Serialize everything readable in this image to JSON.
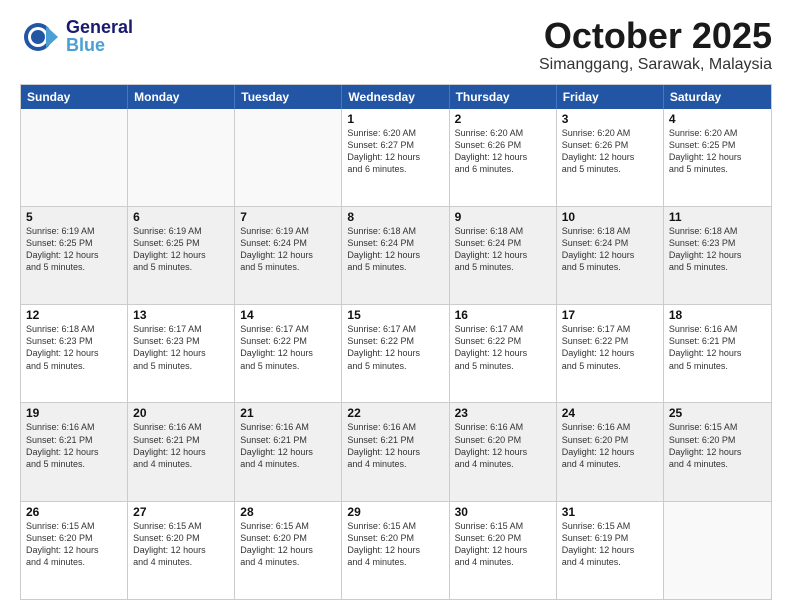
{
  "header": {
    "logo_line1": "General",
    "logo_line2": "Blue",
    "month": "October 2025",
    "location": "Simanggang, Sarawak, Malaysia"
  },
  "weekdays": [
    "Sunday",
    "Monday",
    "Tuesday",
    "Wednesday",
    "Thursday",
    "Friday",
    "Saturday"
  ],
  "rows": [
    [
      {
        "day": "",
        "text": ""
      },
      {
        "day": "",
        "text": ""
      },
      {
        "day": "",
        "text": ""
      },
      {
        "day": "1",
        "text": "Sunrise: 6:20 AM\nSunset: 6:27 PM\nDaylight: 12 hours\nand 6 minutes."
      },
      {
        "day": "2",
        "text": "Sunrise: 6:20 AM\nSunset: 6:26 PM\nDaylight: 12 hours\nand 6 minutes."
      },
      {
        "day": "3",
        "text": "Sunrise: 6:20 AM\nSunset: 6:26 PM\nDaylight: 12 hours\nand 5 minutes."
      },
      {
        "day": "4",
        "text": "Sunrise: 6:20 AM\nSunset: 6:25 PM\nDaylight: 12 hours\nand 5 minutes."
      }
    ],
    [
      {
        "day": "5",
        "text": "Sunrise: 6:19 AM\nSunset: 6:25 PM\nDaylight: 12 hours\nand 5 minutes."
      },
      {
        "day": "6",
        "text": "Sunrise: 6:19 AM\nSunset: 6:25 PM\nDaylight: 12 hours\nand 5 minutes."
      },
      {
        "day": "7",
        "text": "Sunrise: 6:19 AM\nSunset: 6:24 PM\nDaylight: 12 hours\nand 5 minutes."
      },
      {
        "day": "8",
        "text": "Sunrise: 6:18 AM\nSunset: 6:24 PM\nDaylight: 12 hours\nand 5 minutes."
      },
      {
        "day": "9",
        "text": "Sunrise: 6:18 AM\nSunset: 6:24 PM\nDaylight: 12 hours\nand 5 minutes."
      },
      {
        "day": "10",
        "text": "Sunrise: 6:18 AM\nSunset: 6:24 PM\nDaylight: 12 hours\nand 5 minutes."
      },
      {
        "day": "11",
        "text": "Sunrise: 6:18 AM\nSunset: 6:23 PM\nDaylight: 12 hours\nand 5 minutes."
      }
    ],
    [
      {
        "day": "12",
        "text": "Sunrise: 6:18 AM\nSunset: 6:23 PM\nDaylight: 12 hours\nand 5 minutes."
      },
      {
        "day": "13",
        "text": "Sunrise: 6:17 AM\nSunset: 6:23 PM\nDaylight: 12 hours\nand 5 minutes."
      },
      {
        "day": "14",
        "text": "Sunrise: 6:17 AM\nSunset: 6:22 PM\nDaylight: 12 hours\nand 5 minutes."
      },
      {
        "day": "15",
        "text": "Sunrise: 6:17 AM\nSunset: 6:22 PM\nDaylight: 12 hours\nand 5 minutes."
      },
      {
        "day": "16",
        "text": "Sunrise: 6:17 AM\nSunset: 6:22 PM\nDaylight: 12 hours\nand 5 minutes."
      },
      {
        "day": "17",
        "text": "Sunrise: 6:17 AM\nSunset: 6:22 PM\nDaylight: 12 hours\nand 5 minutes."
      },
      {
        "day": "18",
        "text": "Sunrise: 6:16 AM\nSunset: 6:21 PM\nDaylight: 12 hours\nand 5 minutes."
      }
    ],
    [
      {
        "day": "19",
        "text": "Sunrise: 6:16 AM\nSunset: 6:21 PM\nDaylight: 12 hours\nand 5 minutes."
      },
      {
        "day": "20",
        "text": "Sunrise: 6:16 AM\nSunset: 6:21 PM\nDaylight: 12 hours\nand 4 minutes."
      },
      {
        "day": "21",
        "text": "Sunrise: 6:16 AM\nSunset: 6:21 PM\nDaylight: 12 hours\nand 4 minutes."
      },
      {
        "day": "22",
        "text": "Sunrise: 6:16 AM\nSunset: 6:21 PM\nDaylight: 12 hours\nand 4 minutes."
      },
      {
        "day": "23",
        "text": "Sunrise: 6:16 AM\nSunset: 6:20 PM\nDaylight: 12 hours\nand 4 minutes."
      },
      {
        "day": "24",
        "text": "Sunrise: 6:16 AM\nSunset: 6:20 PM\nDaylight: 12 hours\nand 4 minutes."
      },
      {
        "day": "25",
        "text": "Sunrise: 6:15 AM\nSunset: 6:20 PM\nDaylight: 12 hours\nand 4 minutes."
      }
    ],
    [
      {
        "day": "26",
        "text": "Sunrise: 6:15 AM\nSunset: 6:20 PM\nDaylight: 12 hours\nand 4 minutes."
      },
      {
        "day": "27",
        "text": "Sunrise: 6:15 AM\nSunset: 6:20 PM\nDaylight: 12 hours\nand 4 minutes."
      },
      {
        "day": "28",
        "text": "Sunrise: 6:15 AM\nSunset: 6:20 PM\nDaylight: 12 hours\nand 4 minutes."
      },
      {
        "day": "29",
        "text": "Sunrise: 6:15 AM\nSunset: 6:20 PM\nDaylight: 12 hours\nand 4 minutes."
      },
      {
        "day": "30",
        "text": "Sunrise: 6:15 AM\nSunset: 6:20 PM\nDaylight: 12 hours\nand 4 minutes."
      },
      {
        "day": "31",
        "text": "Sunrise: 6:15 AM\nSunset: 6:19 PM\nDaylight: 12 hours\nand 4 minutes."
      },
      {
        "day": "",
        "text": ""
      }
    ]
  ]
}
